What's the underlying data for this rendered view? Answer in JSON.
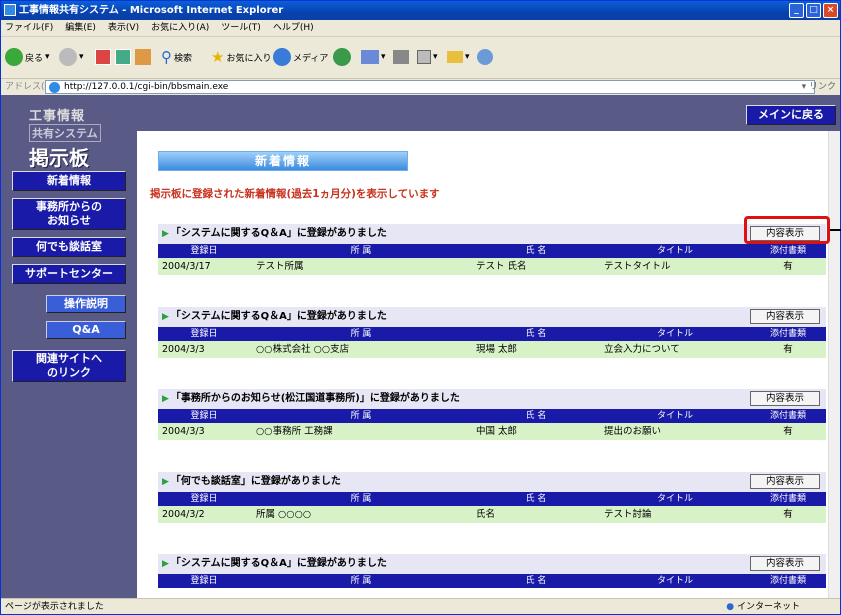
{
  "window": {
    "title": "工事情報共有システム - Microsoft Internet Explorer"
  },
  "menu": [
    "ファイル(F)",
    "編集(E)",
    "表示(V)",
    "お気に入り(A)",
    "ツール(T)",
    "ヘルプ(H)"
  ],
  "toolbar": {
    "back": "戻る",
    "search": "検索",
    "favorites": "お気に入り",
    "media": "メディア"
  },
  "address": {
    "label": "アドレス(D)",
    "url": "http://127.0.0.1/cgi-bin/bbsmain.exe",
    "go": "リンク"
  },
  "logo": {
    "line1": "工事情報",
    "line2": "共有システム",
    "line3": "掲示板"
  },
  "nav": {
    "main_return": "メインに戻る",
    "items": [
      "新着情報",
      "事務所からの\nお知らせ",
      "何でも談話室",
      "サポートセンター",
      "関連サイトへ\nのリンク"
    ],
    "sub": [
      "操作説明",
      "Q&A"
    ]
  },
  "page": {
    "title": "新着情報",
    "intro": "掲示板に登録された新着情報(過去1ヵ月分)を表示しています",
    "show_label": "内容表示",
    "columns": [
      "登録日",
      "所 属",
      "氏 名",
      "タイトル",
      "添付書類"
    ]
  },
  "entries": [
    {
      "header": "「システムに関するQ＆A」に登録がありました",
      "date": "2004/3/17",
      "dept": "テスト所属",
      "name": "テスト 氏名",
      "title": "テストタイトル",
      "attach": "有"
    },
    {
      "header": "「システムに関するQ＆A」に登録がありました",
      "date": "2004/3/3",
      "dept": "○○株式会社 ○○支店",
      "name": "現場 太郎",
      "title": "立会入力について",
      "attach": "有"
    },
    {
      "header": "「事務所からのお知らせ(松江国道事務所)」に登録がありました",
      "date": "2004/3/3",
      "dept": "○○事務所 工務課",
      "name": "中国 太郎",
      "title": "提出のお願い",
      "attach": "有"
    },
    {
      "header": "「何でも談話室」に登録がありました",
      "date": "2004/3/2",
      "dept": "所属 ○○○○",
      "name": "氏名",
      "title": "テスト討論",
      "attach": "有"
    },
    {
      "header": "「システムに関するQ＆A」に登録がありました"
    }
  ],
  "status": {
    "left": "ページが表示されました",
    "zone": "インターネット"
  }
}
